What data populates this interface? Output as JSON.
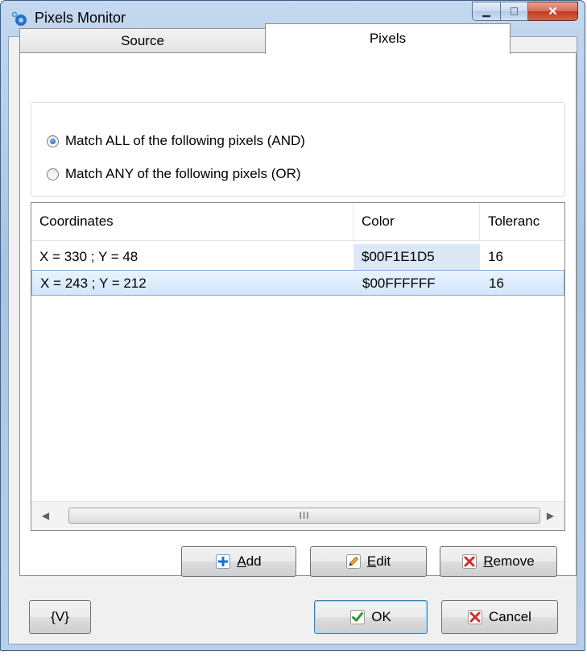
{
  "window": {
    "title": "Pixels Monitor",
    "minimize_glyph": "▁",
    "maximize_glyph": "□",
    "close_glyph": "✕"
  },
  "tabs": [
    {
      "label": "Source"
    },
    {
      "label": "Pixels",
      "active": true
    }
  ],
  "match_mode": {
    "options": [
      {
        "label": "Match ALL of the following pixels (AND)",
        "checked": true
      },
      {
        "label": "Match ANY of the following pixels (OR)",
        "checked": false
      }
    ]
  },
  "pixel_list": {
    "columns": [
      "Coordinates",
      "Color",
      "Toleranc"
    ],
    "rows": [
      {
        "coordinates": "X = 330 ; Y = 48",
        "color": "$00F1E1D5",
        "tolerance": "16"
      },
      {
        "coordinates": "X = 243 ; Y = 212",
        "color": "$00FFFFFF",
        "tolerance": "16",
        "selected": true
      }
    ],
    "scroll_left": "◀",
    "scroll_right": "▶",
    "grip": "III"
  },
  "list_buttons": {
    "add": {
      "accel": "A",
      "rest": "dd"
    },
    "edit": {
      "accel": "E",
      "rest": "dit"
    },
    "remove": {
      "accel": "R",
      "rest": "emove"
    }
  },
  "footer": {
    "variables_label": "{V}",
    "ok_label": "OK",
    "cancel_label": "Cancel"
  },
  "colors": {
    "selection": "#d2e6fb",
    "add_icon": "#1f6fd1",
    "remove_icon": "#d42b2b",
    "ok_icon": "#2e9a2e"
  }
}
